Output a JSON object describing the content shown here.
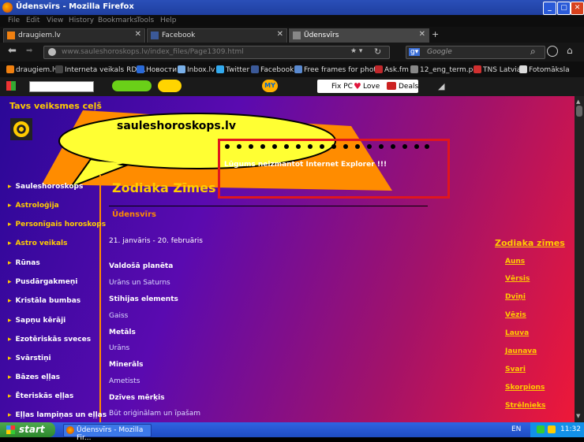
{
  "window": {
    "title": "Ūdensvīrs - Mozilla Firefox"
  },
  "menu": [
    "File",
    "Edit",
    "View",
    "History",
    "Bookmarks",
    "Tools",
    "Help"
  ],
  "tabs": [
    {
      "label": "draugiem.lv"
    },
    {
      "label": "Facebook"
    },
    {
      "label": "Ūdensvīrs"
    }
  ],
  "newtab": "+",
  "nav": {
    "url": "www.saulеshoroskops.lv/index_files/Page1309.html",
    "search_placeholder": "Google"
  },
  "bookmarks": [
    "draugiem.lv",
    "Interneta veikals RD ...",
    "Новости",
    "Inbox.lv",
    "Twitter",
    "Facebook",
    "Free frames for phot...",
    "Ask.fm",
    "12_eng_term.pdf",
    "TNS Latvia",
    "Fotomāksla"
  ],
  "addon": {
    "fixpc": "Fix PC",
    "love": "Love",
    "deals": "Deals",
    "my": "MY"
  },
  "site": {
    "tagline": "Tavs veiksmes ceļš",
    "logo": "sauleshoroskops.lv",
    "ie_notice": "Lūgums neizmantot Internet Explorer !!!",
    "heading": "Zodiaka Zīmes",
    "sign_title": "Ūdensvīrs",
    "dates": "21. janvāris - 20. februāris"
  },
  "sidebar": [
    "Sauleshoroskops",
    "Astroloģija",
    "Personīgais horoskops",
    "Astro veikals",
    "Rūnas",
    "Pusdārgakmeņi",
    "Kristāla bumbas",
    "Sapņu kērāji",
    "Ezotēriskās sveces",
    "Svārstiņi",
    "Bāzes eļļas",
    "Ēteriskās eļļas",
    "Eļļas lampiņas un eļļas"
  ],
  "info": [
    {
      "label": "Valdošā planēta",
      "value": "Urāns un Saturns"
    },
    {
      "label": "Stihijas elements",
      "value": "Gaiss"
    },
    {
      "label": "Metāls",
      "value": "Urāns"
    },
    {
      "label": "Minerāls",
      "value": "Ametists"
    },
    {
      "label": "Dzīves mērķis",
      "value": "Būt oriģinālam un īpašam"
    }
  ],
  "zodiac": {
    "title": "Zodiaka zīmes",
    "signs": [
      "Auns",
      "Vērsis",
      "Dvīņi",
      "Vēzis",
      "Lauva",
      "Jaunava",
      "Svari",
      "Skorpions",
      "Strēlnieks"
    ]
  },
  "taskbar": {
    "start": "start",
    "item": "Ūdensvīrs - Mozilla Fir...",
    "lang": "EN",
    "time": "11:32"
  }
}
